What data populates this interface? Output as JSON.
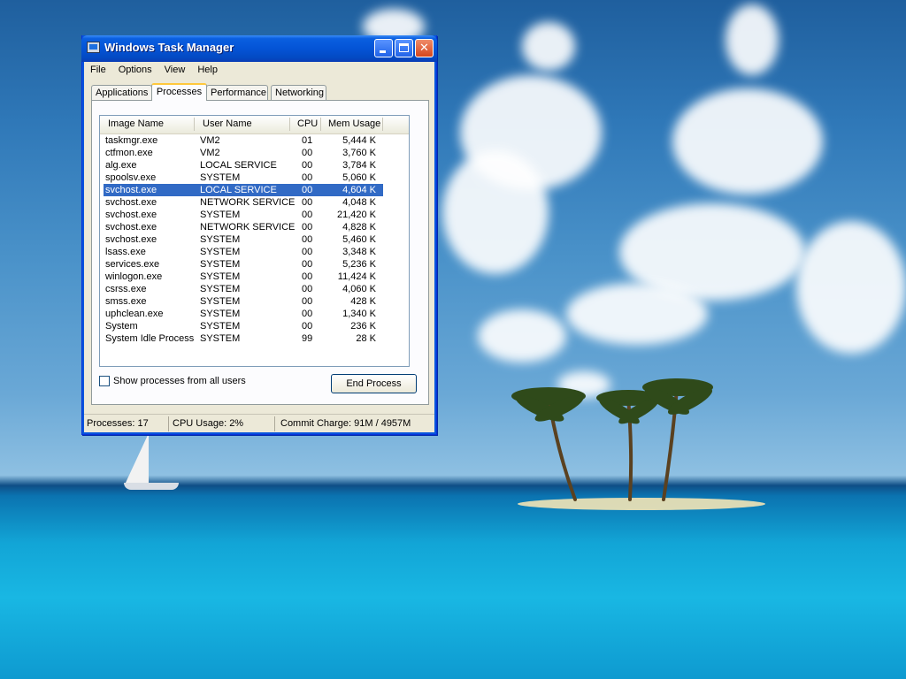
{
  "window": {
    "title": "Windows Task Manager",
    "minimize_label": "",
    "maximize_label": "",
    "close_label": "✕"
  },
  "menu": [
    "File",
    "Options",
    "View",
    "Help"
  ],
  "tabs": [
    {
      "label": "Applications",
      "active": false
    },
    {
      "label": "Processes",
      "active": true
    },
    {
      "label": "Performance",
      "active": false
    },
    {
      "label": "Networking",
      "active": false
    }
  ],
  "columns": [
    "Image Name",
    "User Name",
    "CPU",
    "Mem Usage"
  ],
  "processes": [
    {
      "name": "taskmgr.exe",
      "user": "VM2",
      "cpu": "01",
      "mem": "5,444 K"
    },
    {
      "name": "ctfmon.exe",
      "user": "VM2",
      "cpu": "00",
      "mem": "3,760 K"
    },
    {
      "name": "alg.exe",
      "user": "LOCAL SERVICE",
      "cpu": "00",
      "mem": "3,784 K"
    },
    {
      "name": "spoolsv.exe",
      "user": "SYSTEM",
      "cpu": "00",
      "mem": "5,060 K"
    },
    {
      "name": "svchost.exe",
      "user": "LOCAL SERVICE",
      "cpu": "00",
      "mem": "4,604 K",
      "selected": true
    },
    {
      "name": "svchost.exe",
      "user": "NETWORK SERVICE",
      "cpu": "00",
      "mem": "4,048 K"
    },
    {
      "name": "svchost.exe",
      "user": "SYSTEM",
      "cpu": "00",
      "mem": "21,420 K"
    },
    {
      "name": "svchost.exe",
      "user": "NETWORK SERVICE",
      "cpu": "00",
      "mem": "4,828 K"
    },
    {
      "name": "svchost.exe",
      "user": "SYSTEM",
      "cpu": "00",
      "mem": "5,460 K"
    },
    {
      "name": "lsass.exe",
      "user": "SYSTEM",
      "cpu": "00",
      "mem": "3,348 K"
    },
    {
      "name": "services.exe",
      "user": "SYSTEM",
      "cpu": "00",
      "mem": "5,236 K"
    },
    {
      "name": "winlogon.exe",
      "user": "SYSTEM",
      "cpu": "00",
      "mem": "11,424 K"
    },
    {
      "name": "csrss.exe",
      "user": "SYSTEM",
      "cpu": "00",
      "mem": "4,060 K"
    },
    {
      "name": "smss.exe",
      "user": "SYSTEM",
      "cpu": "00",
      "mem": "428 K"
    },
    {
      "name": "uphclean.exe",
      "user": "SYSTEM",
      "cpu": "00",
      "mem": "1,340 K"
    },
    {
      "name": "System",
      "user": "SYSTEM",
      "cpu": "00",
      "mem": "236 K"
    },
    {
      "name": "System Idle Process",
      "user": "SYSTEM",
      "cpu": "99",
      "mem": "28 K"
    }
  ],
  "show_all_users": {
    "label": "Show processes from all users",
    "checked": false
  },
  "end_process_label": "End Process",
  "status": {
    "processes": "Processes: 17",
    "cpu_usage": "CPU Usage: 2%",
    "commit_charge": "Commit Charge: 91M / 4957M"
  },
  "colors": {
    "titlebar": "#0454d6",
    "selection": "#316ac5",
    "window_face": "#ece9d8",
    "active_tab_accent": "#ffc83c"
  }
}
